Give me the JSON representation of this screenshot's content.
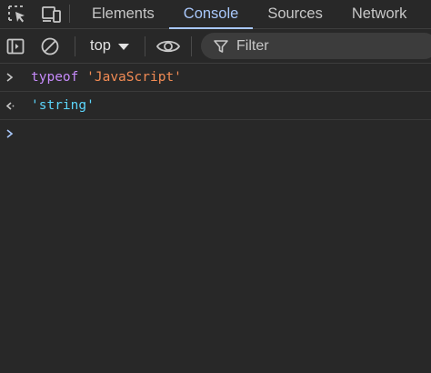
{
  "tabs": [
    {
      "label": "Elements",
      "active": false
    },
    {
      "label": "Console",
      "active": true
    },
    {
      "label": "Sources",
      "active": false
    },
    {
      "label": "Network",
      "active": false
    }
  ],
  "toolbar": {
    "context": "top",
    "filter_placeholder": "Filter"
  },
  "console": {
    "input": {
      "keyword": "typeof",
      "string": "'JavaScript'"
    },
    "result": "'string'"
  },
  "colors": {
    "accent": "#a8c7fa",
    "keyword": "#c58af9",
    "string": "#f28b54",
    "result": "#5cd5fb"
  }
}
